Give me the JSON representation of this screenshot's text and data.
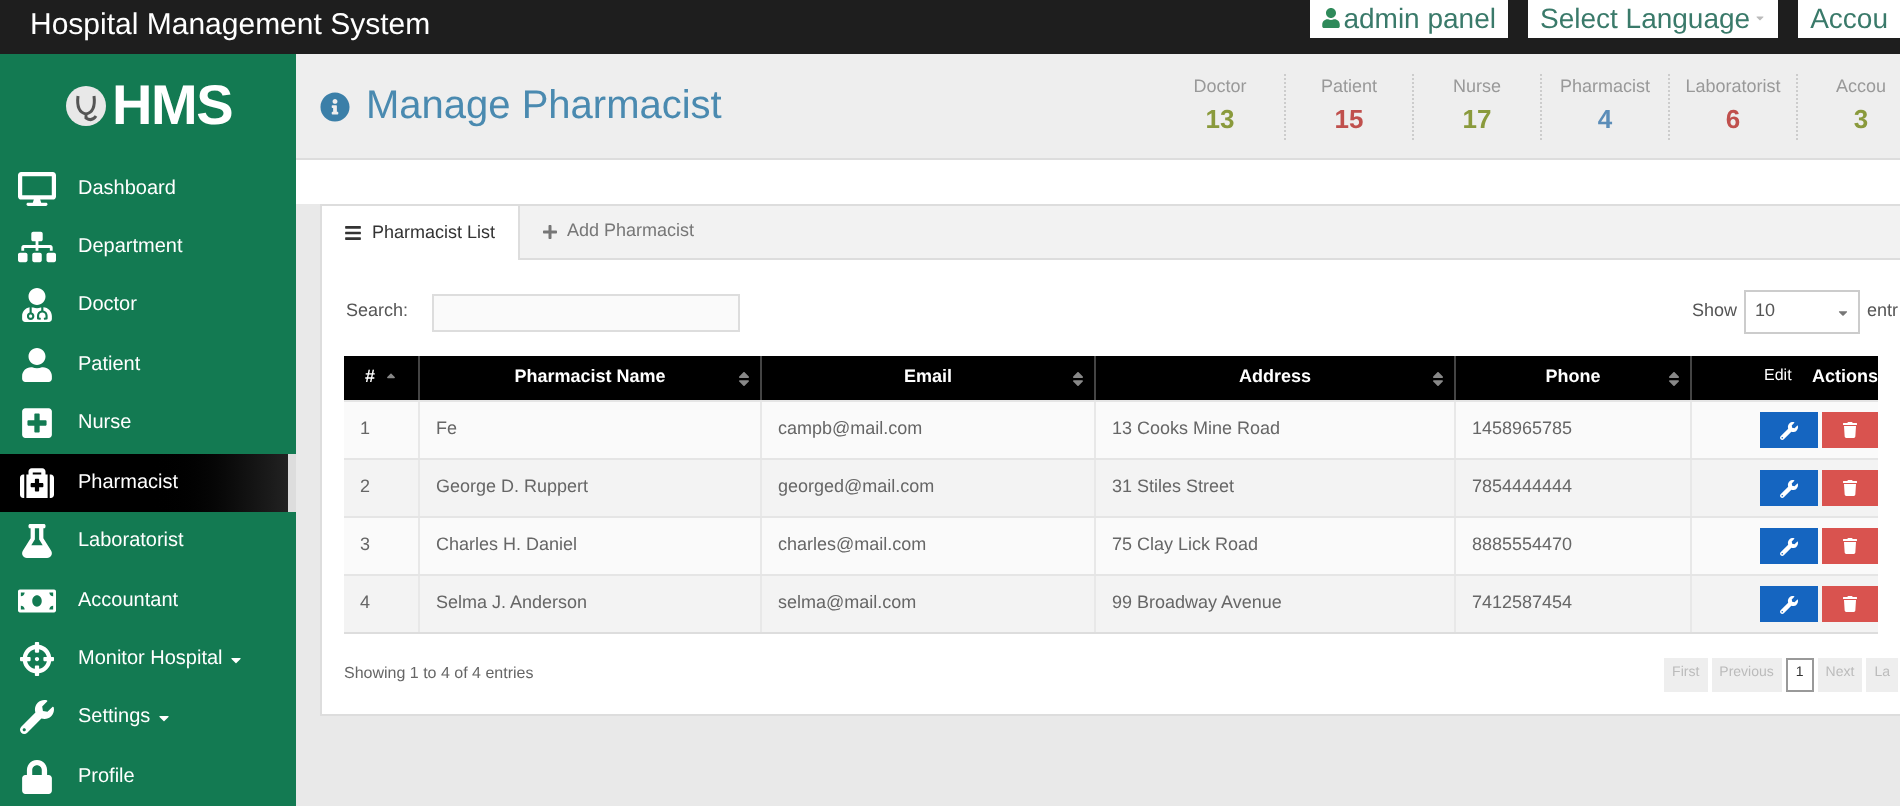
{
  "topbar": {
    "title": "Hospital Management System",
    "buttons": [
      "admin panel",
      "Select Language",
      "Accou"
    ]
  },
  "sidebar": {
    "logo": "HMS",
    "items": [
      {
        "label": "Dashboard",
        "selected": false,
        "dropdown": false
      },
      {
        "label": "Department",
        "selected": false,
        "dropdown": false
      },
      {
        "label": "Doctor",
        "selected": false,
        "dropdown": false
      },
      {
        "label": "Patient",
        "selected": false,
        "dropdown": false
      },
      {
        "label": "Nurse",
        "selected": false,
        "dropdown": false
      },
      {
        "label": "Pharmacist",
        "selected": true,
        "dropdown": false
      },
      {
        "label": "Laboratorist",
        "selected": false,
        "dropdown": false
      },
      {
        "label": "Accountant",
        "selected": false,
        "dropdown": false
      },
      {
        "label": "Monitor Hospital",
        "selected": false,
        "dropdown": true
      },
      {
        "label": "Settings",
        "selected": false,
        "dropdown": true
      },
      {
        "label": "Profile",
        "selected": false,
        "dropdown": false
      }
    ]
  },
  "page": {
    "title": "Manage Pharmacist",
    "stats": [
      {
        "label": "Doctor",
        "value": "13",
        "color": "#8a9a3c"
      },
      {
        "label": "Patient",
        "value": "15",
        "color": "#c0504d"
      },
      {
        "label": "Nurse",
        "value": "17",
        "color": "#8a9a3c"
      },
      {
        "label": "Pharmacist",
        "value": "4",
        "color": "#5b8db8"
      },
      {
        "label": "Laboratorist",
        "value": "6",
        "color": "#c0504d"
      },
      {
        "label": "Accou",
        "value": "3",
        "color": "#8a9a3c"
      }
    ]
  },
  "tabs": [
    {
      "label": "Pharmacist List",
      "selected": true
    },
    {
      "label": "Add Pharmacist",
      "selected": false
    }
  ],
  "search": {
    "label": "Search:"
  },
  "length": {
    "label": "Show",
    "value": "10",
    "suffix": "entr"
  },
  "table": {
    "columns": [
      "#",
      "Pharmacist Name",
      "Email",
      "Address",
      "Phone",
      "Actions"
    ],
    "rows": [
      [
        "1",
        "Fe",
        "campb@mail.com",
        "13 Cooks Mine Road",
        "1458965785"
      ],
      [
        "2",
        "George D. Ruppert",
        "georged@mail.com",
        "31 Stiles Street",
        "7854444444"
      ],
      [
        "3",
        "Charles H. Daniel",
        "charles@mail.com",
        "75 Clay Lick Road",
        "8885554470"
      ],
      [
        "4",
        "Selma J. Anderson",
        "selma@mail.com",
        "99 Broadway Avenue",
        "7412587454"
      ]
    ],
    "tooltip": "Edit"
  },
  "info": "Showing 1 to 4 of 4 entries",
  "pagination": [
    {
      "label": "First",
      "selected": false
    },
    {
      "label": "Previous",
      "selected": false
    },
    {
      "label": "1",
      "selected": true
    },
    {
      "label": "Next",
      "selected": false
    },
    {
      "label": "La",
      "selected": false
    }
  ]
}
